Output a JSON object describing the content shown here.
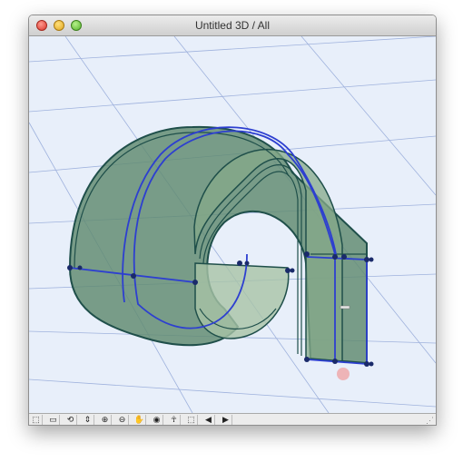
{
  "window": {
    "title": "Untitled 3D / All"
  },
  "controls": {
    "close": "close-icon",
    "minimize": "minimize-icon",
    "zoom": "zoom-icon"
  },
  "viewport": {
    "background": "#e8effa",
    "grid_color": "#9fb2dd",
    "surface_fill": "#5f8a6f",
    "surface_edge": "#1f4f4a",
    "path_color": "#2d3fd0",
    "node_color": "#1a2a6a"
  },
  "toolbar": {
    "tools": [
      "3d-view-icon",
      "page-icon",
      "orbit-icon",
      "zoom-vertical-icon",
      "zoom-in-icon",
      "zoom-out-icon",
      "hand-pan-icon",
      "eye-icon",
      "walk-icon",
      "zoom-window-icon",
      "zoom-previous-icon",
      "zoom-next-icon"
    ],
    "glyphs": [
      "⬚",
      "▭",
      "⟲",
      "⇕",
      "⊕",
      "⊖",
      "✋",
      "◉",
      "☥",
      "⬚",
      "◀",
      "▶"
    ]
  }
}
